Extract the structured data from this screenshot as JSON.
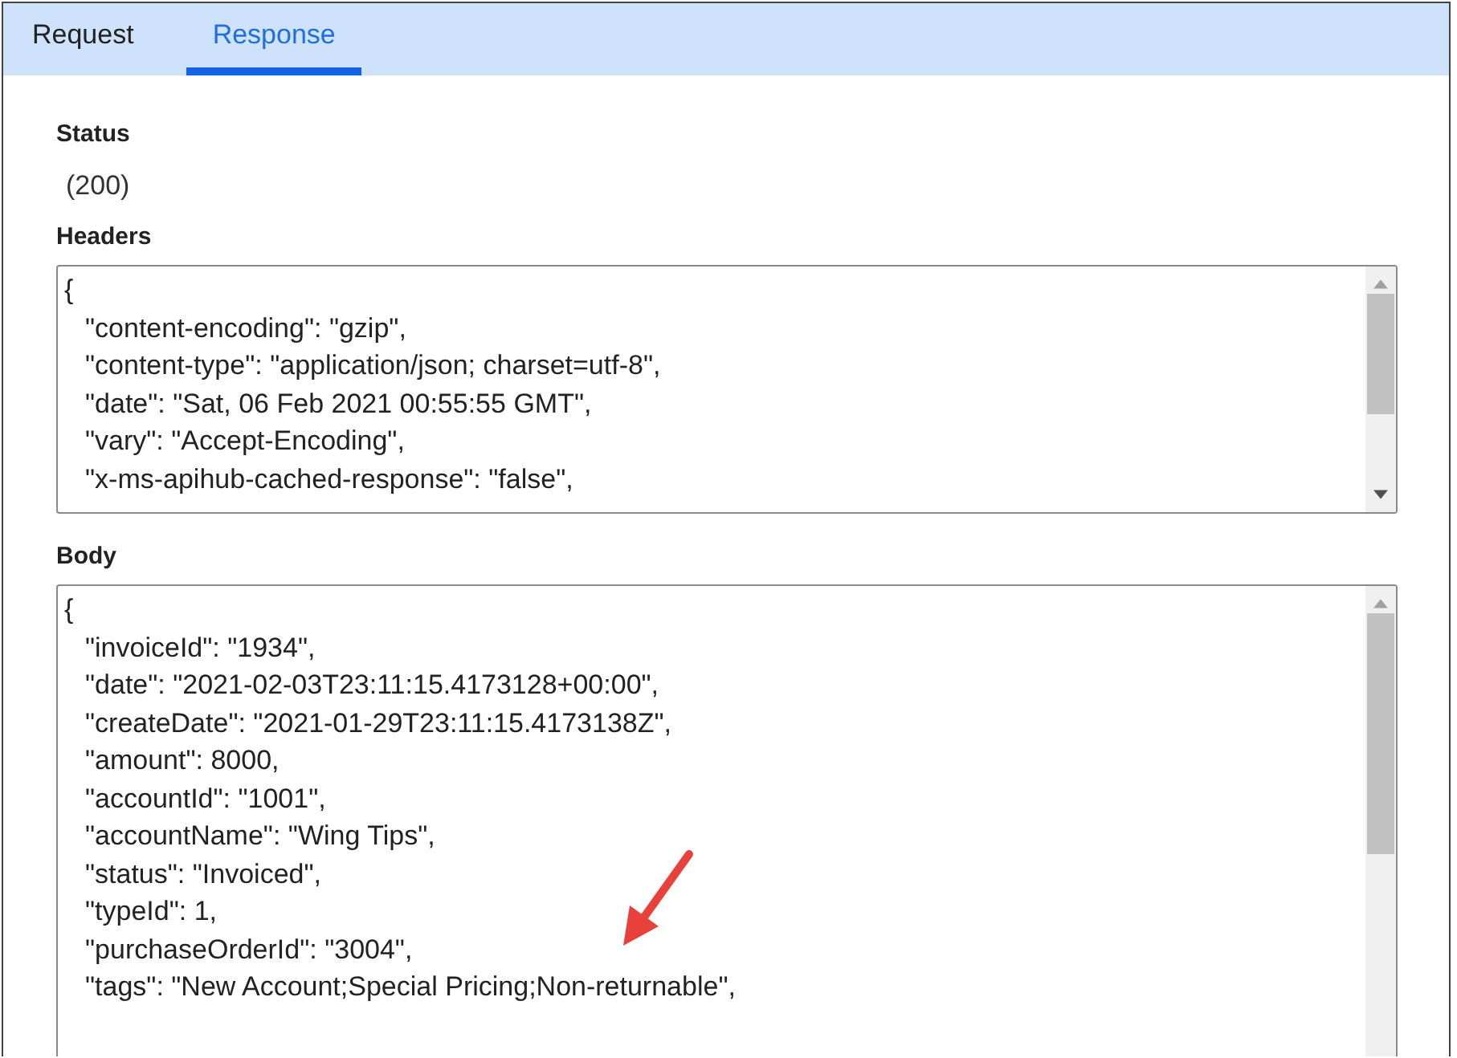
{
  "tabs": [
    {
      "label": "Request",
      "selected": false
    },
    {
      "label": "Response",
      "selected": true
    }
  ],
  "sections": [
    {
      "title": "Status",
      "kind": "value",
      "value": "(200)"
    },
    {
      "title": "Headers",
      "kind": "code",
      "lines": [
        {
          "kind": "brace",
          "text": "{"
        },
        {
          "kind": "entry",
          "text": "\"content-encoding\": \"gzip\","
        },
        {
          "kind": "entry",
          "text": "\"content-type\": \"application/json; charset=utf-8\","
        },
        {
          "kind": "entry",
          "text": "\"date\": \"Sat, 06 Feb 2021 00:55:55 GMT\","
        },
        {
          "kind": "entry",
          "text": "\"vary\": \"Accept-Encoding\","
        },
        {
          "kind": "entry",
          "text": "\"x-ms-apihub-cached-response\": \"false\","
        }
      ]
    },
    {
      "title": "Body",
      "kind": "code",
      "lines": [
        {
          "kind": "brace",
          "text": "{"
        },
        {
          "kind": "entry",
          "text": "\"invoiceId\": \"1934\","
        },
        {
          "kind": "entry",
          "text": "\"date\": \"2021-02-03T23:11:15.4173128+00:00\","
        },
        {
          "kind": "entry",
          "text": "\"createDate\": \"2021-01-29T23:11:15.4173138Z\","
        },
        {
          "kind": "entry",
          "text": "\"amount\": 8000,"
        },
        {
          "kind": "entry",
          "text": "\"accountId\": \"1001\","
        },
        {
          "kind": "entry",
          "text": "\"accountName\": \"Wing Tips\","
        },
        {
          "kind": "entry",
          "text": "\"status\": \"Invoiced\","
        },
        {
          "kind": "entry",
          "text": "\"typeId\": 1,"
        },
        {
          "kind": "entry",
          "text": "\"purchaseOrderId\": \"3004\","
        },
        {
          "kind": "entry",
          "text": "\"tags\": \"New Account;Special Pricing;Non-returnable\","
        }
      ]
    }
  ]
}
